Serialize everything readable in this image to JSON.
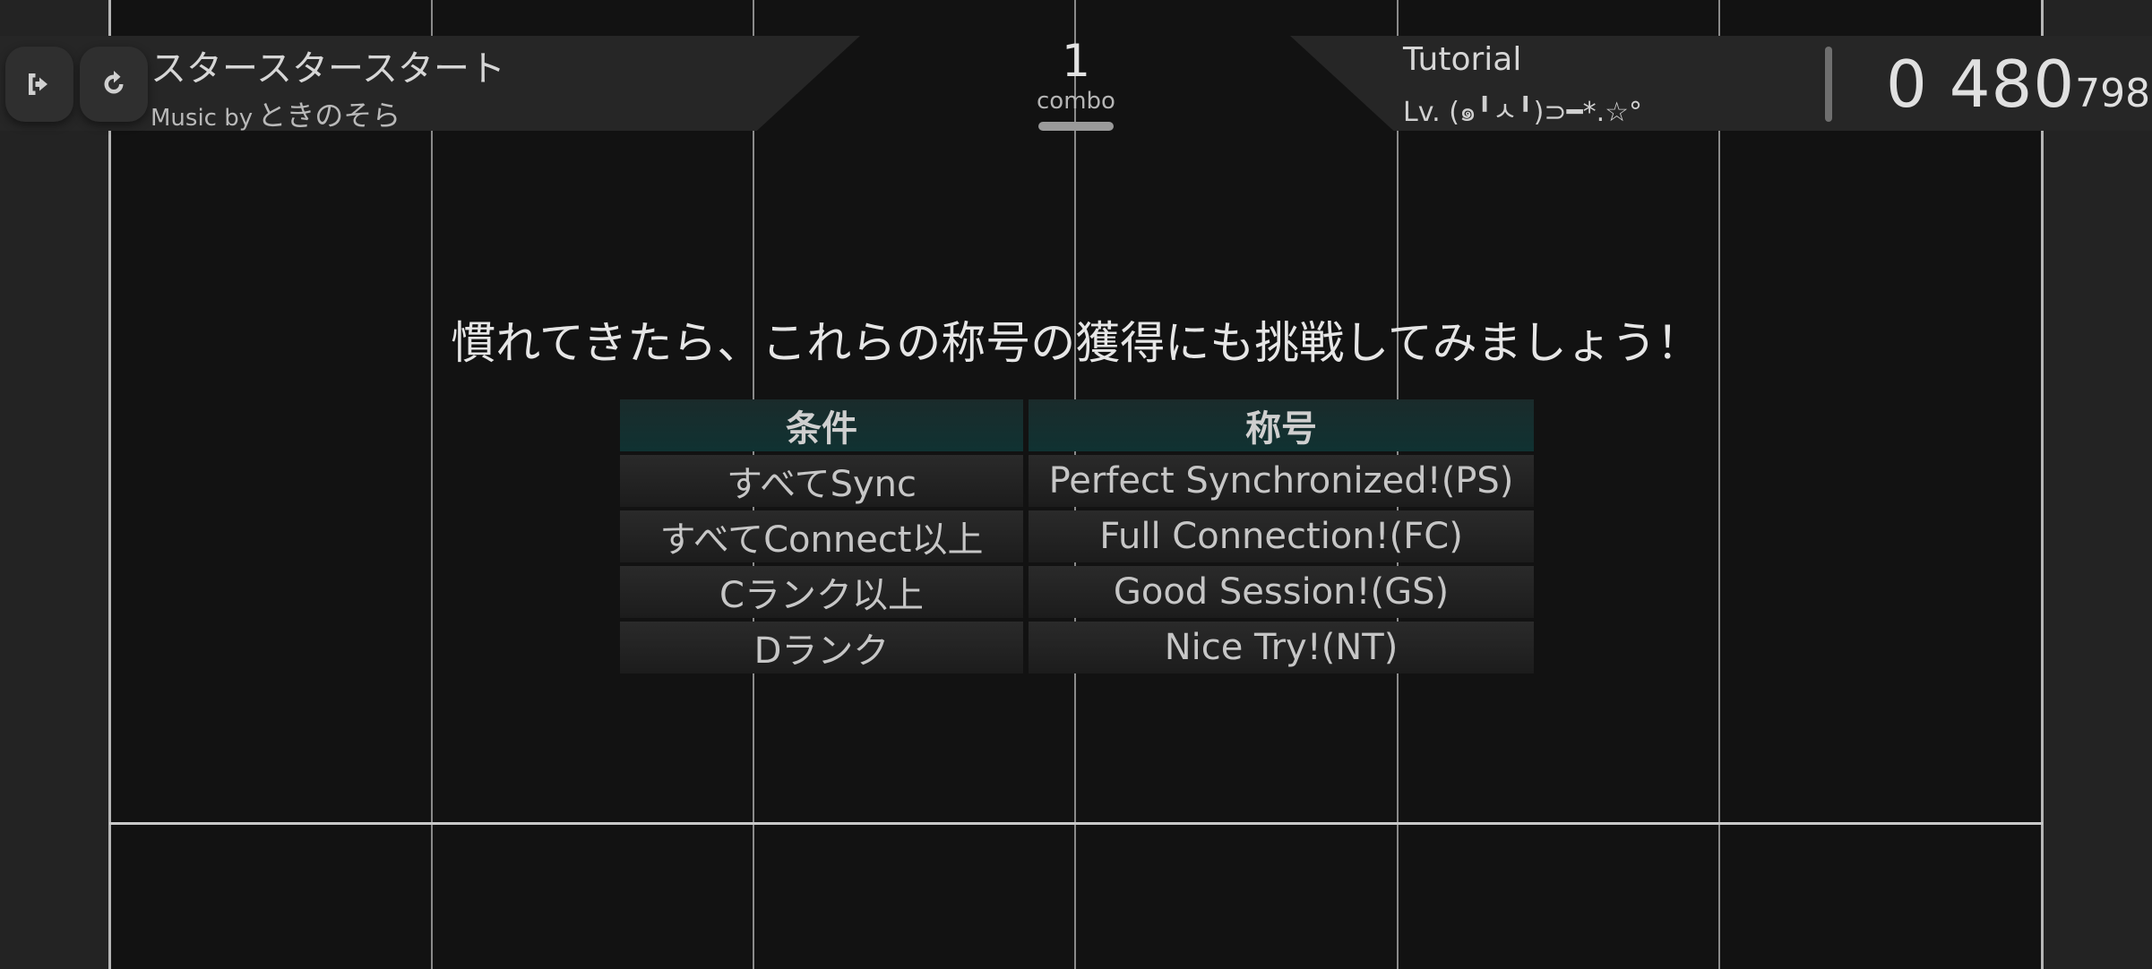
{
  "header": {
    "exit_icon": "exit-icon",
    "retry_icon": "retry-icon",
    "song_title": "スタースタースタート",
    "artist_prefix": "Music by",
    "artist": "ときのそら",
    "combo_count": "1",
    "combo_label": "combo",
    "chart_name": "Tutorial",
    "chart_level": "Lv. (๑╹ㅅ╹)⊃━*.☆°",
    "score_main": "0 480",
    "score_sub": "798"
  },
  "tutorial": {
    "message": "慣れてきたら、これらの称号の獲得にも挑戦してみましょう！",
    "table": {
      "headers": [
        "条件",
        "称号"
      ],
      "rows": [
        [
          "すべてSync",
          "Perfect Synchronized!(PS)"
        ],
        [
          "すべてConnect以上",
          "Full Connection!(FC)"
        ],
        [
          "Cランク以上",
          "Good Session!(GS)"
        ],
        [
          "Dランク",
          "Nice Try!(NT)"
        ]
      ]
    }
  },
  "colors": {
    "background": "#121212",
    "lane_line": "#8a8a8a",
    "header_panel": "#262626",
    "table_header": "#103232"
  }
}
